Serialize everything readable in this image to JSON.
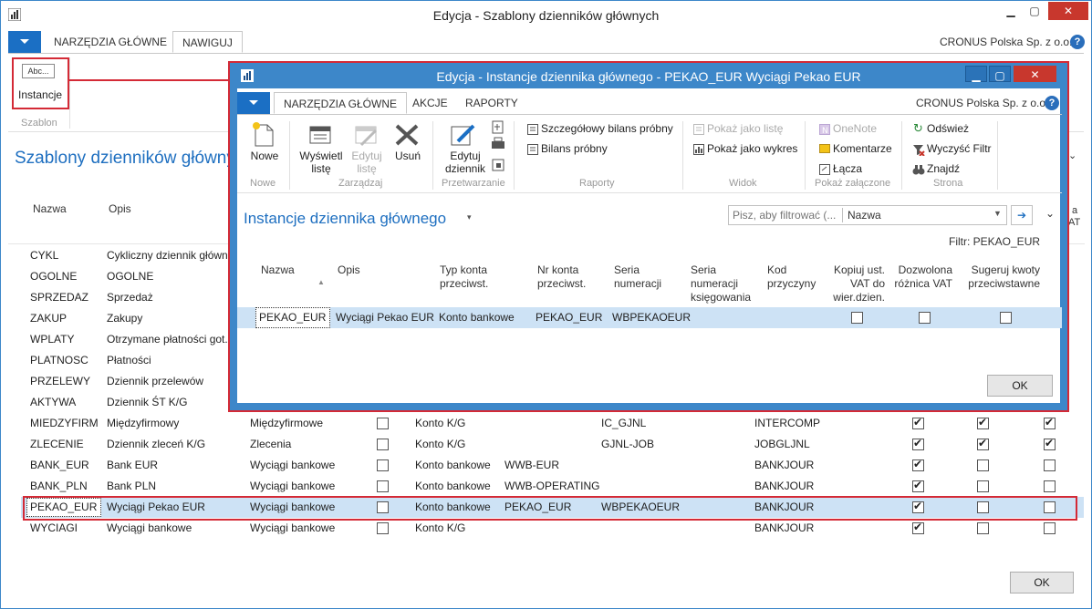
{
  "outer": {
    "title": "Edycja - Szablony dzienników głównych",
    "tabs": [
      "NARZĘDZIA GŁÓWNE",
      "NAWIGUJ"
    ],
    "company": "CRONUS Polska Sp. z o.o.",
    "help": "?",
    "instancje_icon_text": "Abc...",
    "instancje_label": "Instancje",
    "group_label": "Szablon",
    "page_title": "Szablony dzienników głównyc",
    "headers": {
      "nazwa": "Nazwa",
      "opis": "Opis",
      "tail": "a",
      "tail2": "AT"
    },
    "rows": [
      {
        "nazwa": "CYKL",
        "opis": "Cykliczny dziennik główn"
      },
      {
        "nazwa": "OGOLNE",
        "opis": "OGOLNE"
      },
      {
        "nazwa": "SPRZEDAZ",
        "opis": "Sprzedaż"
      },
      {
        "nazwa": "ZAKUP",
        "opis": "Zakupy"
      },
      {
        "nazwa": "WPLATY",
        "opis": "Otrzymane płatności got."
      },
      {
        "nazwa": "PLATNOSC",
        "opis": "Płatności"
      },
      {
        "nazwa": "PRZELEWY",
        "opis": "Dziennik przelewów"
      },
      {
        "nazwa": "AKTYWA",
        "opis": "Dziennik ŚT K/G"
      },
      {
        "nazwa": "MIEDZYFIRM",
        "opis": "Międzyfirmowy",
        "typ": "Międzyfirmowe",
        "konto": "Konto K/G",
        "nr": "",
        "seria": "IC_GJNL",
        "kod": "INTERCOMP",
        "c1": true,
        "c2": true,
        "c3": true
      },
      {
        "nazwa": "ZLECENIE",
        "opis": "Dziennik zleceń K/G",
        "typ": "Zlecenia",
        "konto": "Konto K/G",
        "nr": "",
        "seria": "GJNL-JOB",
        "kod": "JOBGLJNL",
        "c1": true,
        "c2": true,
        "c3": true
      },
      {
        "nazwa": "BANK_EUR",
        "opis": "Bank EUR",
        "typ": "Wyciągi bankowe",
        "konto": "Konto bankowe",
        "nr": "WWB-EUR",
        "seria": "",
        "kod": "BANKJOUR",
        "c1": true,
        "c2": false,
        "c3": false
      },
      {
        "nazwa": "BANK_PLN",
        "opis": "Bank PLN",
        "typ": "Wyciągi bankowe",
        "konto": "Konto bankowe",
        "nr": "WWB-OPERATING",
        "seria": "",
        "kod": "BANKJOUR",
        "c1": true,
        "c2": false,
        "c3": false
      },
      {
        "nazwa": "PEKAO_EUR",
        "opis": "Wyciągi Pekao EUR",
        "typ": "Wyciągi bankowe",
        "konto": "Konto bankowe",
        "nr": "PEKAO_EUR",
        "seria": "WBPEKAOEUR",
        "kod": "BANKJOUR",
        "c1": true,
        "c2": false,
        "c3": false
      },
      {
        "nazwa": "WYCIAGI",
        "opis": "Wyciągi bankowe",
        "typ": "Wyciągi bankowe",
        "konto": "Konto K/G",
        "nr": "",
        "seria": "",
        "kod": "BANKJOUR",
        "c1": true,
        "c2": false,
        "c3": false
      }
    ],
    "ok": "OK"
  },
  "inner": {
    "title": "Edycja - Instancje dziennika głównego - PEKAO_EUR Wyciągi Pekao EUR",
    "tabs": [
      "NARZĘDZIA GŁÓWNE",
      "AKCJE",
      "RAPORTY"
    ],
    "company": "CRONUS Polska Sp. z o.o.",
    "actions": {
      "nowe": "Nowe",
      "wyswietl": "Wyświetl listę",
      "edytuj_liste": "Edytuj listę",
      "usun": "Usuń",
      "edytuj_dziennik": "Edytuj dziennik",
      "szczegolowy": "Szczegółowy bilans próbny",
      "bilans": "Bilans próbny",
      "pokaz_liste": "Pokaż jako listę",
      "pokaz_wykres": "Pokaż jako wykres",
      "onenote": "OneNote",
      "komentarze": "Komentarze",
      "lacza": "Łącza",
      "odswiez": "Odśwież",
      "wyczysc": "Wyczyść Filtr",
      "znajdz": "Znajdź"
    },
    "groups": [
      "Nowe",
      "Zarządzaj",
      "Przetwarzanie",
      "Raporty",
      "Widok",
      "Pokaż załączone",
      "Strona"
    ],
    "page_title": "Instancje dziennika głównego",
    "filter_placeholder": "Pisz, aby filtrować (...",
    "filter_field": "Nazwa",
    "filter_info": "Filtr: PEKAO_EUR",
    "headers": {
      "nazwa": "Nazwa",
      "opis": "Opis",
      "typ": "Typ konta przeciwst.",
      "nr": "Nr konta przeciwst.",
      "seria": "Seria numeracji",
      "seria_ks": "Seria numeracji księgowania",
      "kod": "Kod przyczyny",
      "kopiuj": "Kopiuj ust. VAT do wier.dzien.",
      "dozwolona": "Dozwolona różnica VAT",
      "sugeruj": "Sugeruj kwoty przeciwstawne"
    },
    "row": {
      "nazwa": "PEKAO_EUR",
      "opis": "Wyciągi Pekao EUR",
      "typ": "Konto bankowe",
      "nr": "PEKAO_EUR",
      "seria": "WBPEKAOEUR",
      "kopiuj": false,
      "dozwolona": false,
      "sugeruj": false
    },
    "ok": "OK"
  }
}
